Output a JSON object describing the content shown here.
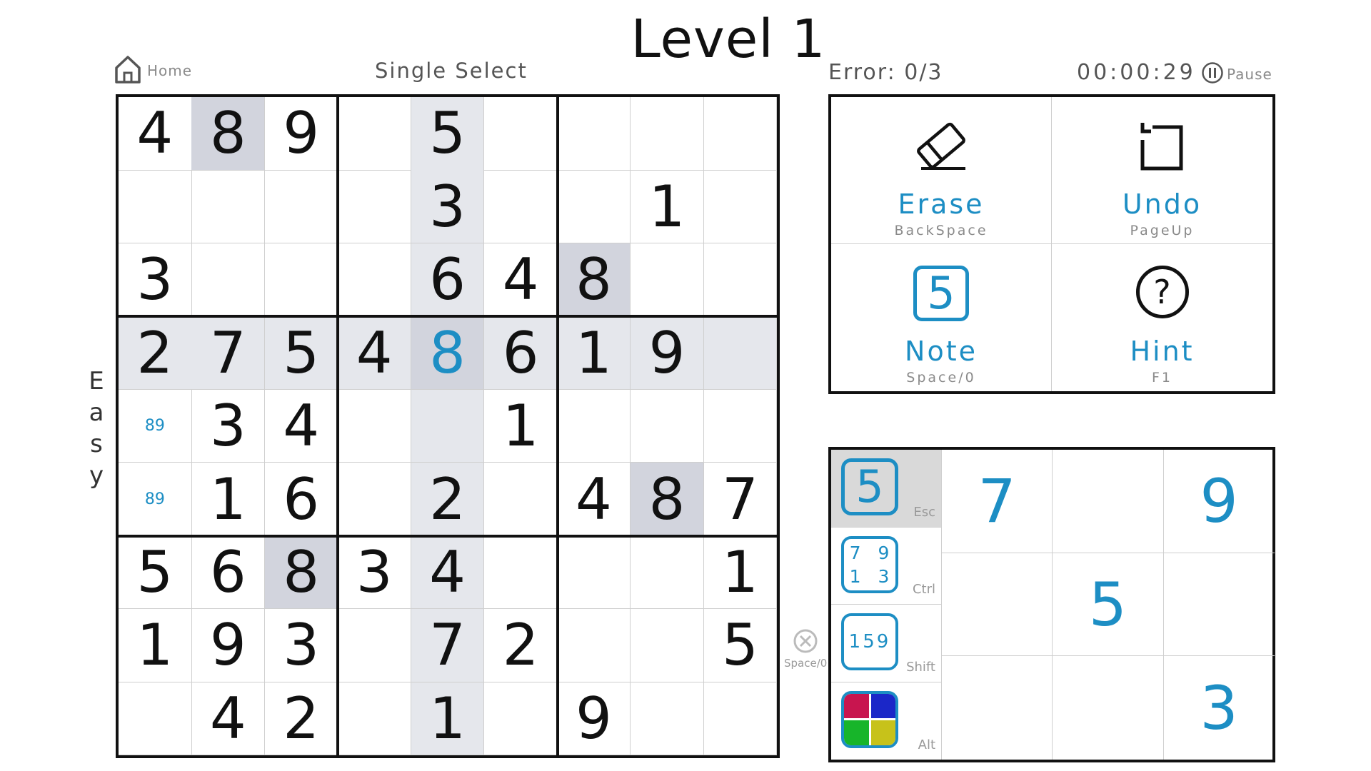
{
  "title": "Level 1",
  "home_label": "Home",
  "mode_label": "Single Select",
  "error_text": "Error: 0/3",
  "timer": "00:00:29",
  "pause_label": "Pause",
  "difficulty": [
    "E",
    "a",
    "s",
    "y"
  ],
  "accent_color": "#1d8ec4",
  "board": {
    "rows": [
      [
        "4",
        "8",
        "9",
        "",
        "5",
        "",
        "",
        "",
        ""
      ],
      [
        "",
        "",
        "",
        "",
        "3",
        "",
        "",
        "1",
        ""
      ],
      [
        "3",
        "",
        "",
        "",
        "6",
        "4",
        "8",
        "",
        ""
      ],
      [
        "2",
        "7",
        "5",
        "4",
        "8",
        "6",
        "1",
        "9",
        ""
      ],
      [
        "89",
        "3",
        "4",
        "",
        "",
        "1",
        "",
        "",
        ""
      ],
      [
        "89",
        "1",
        "6",
        "",
        "2",
        "",
        "4",
        "8",
        "7"
      ],
      [
        "5",
        "6",
        "8",
        "3",
        "4",
        "",
        "",
        "",
        "1"
      ],
      [
        "1",
        "9",
        "3",
        "",
        "7",
        "2",
        "",
        "",
        "5"
      ],
      [
        "",
        "4",
        "2",
        "",
        "1",
        "",
        "9",
        "",
        ""
      ]
    ],
    "note_cells": [
      "4-0",
      "5-0"
    ],
    "user_cells": [
      "3-4"
    ],
    "highlight_row": 3,
    "highlight_col": 4,
    "highlight_box": [
      3,
      3
    ],
    "same_number_cells": [
      "0-1",
      "2-6",
      "5-7",
      "6-2"
    ]
  },
  "actions": [
    {
      "icon": "eraser-icon",
      "label": "Erase",
      "key": "BackSpace"
    },
    {
      "icon": "undo-icon",
      "label": "Undo",
      "key": "PageUp"
    },
    {
      "icon": "note-icon",
      "label": "Note",
      "key": "Space/0",
      "glyph": "5"
    },
    {
      "icon": "hint-icon",
      "label": "Hint",
      "key": "F1",
      "glyph": "?"
    }
  ],
  "input_modes": [
    {
      "icon": "single-number-mode-icon",
      "key": "Esc",
      "glyph": "5",
      "active": true
    },
    {
      "icon": "corner-notes-mode-icon",
      "key": "Ctrl",
      "glyph": "7 9 1 3"
    },
    {
      "icon": "center-notes-mode-icon",
      "key": "Shift",
      "glyph": "159"
    },
    {
      "icon": "color-mode-icon",
      "key": "Alt",
      "colors": [
        "#c8154f",
        "#1b27c8",
        "#17b52a",
        "#c7c21a"
      ]
    }
  ],
  "clear_label": "Space/0",
  "number_pad": [
    [
      "7",
      "",
      "9"
    ],
    [
      "",
      "5",
      ""
    ],
    [
      "",
      "",
      "3"
    ]
  ]
}
